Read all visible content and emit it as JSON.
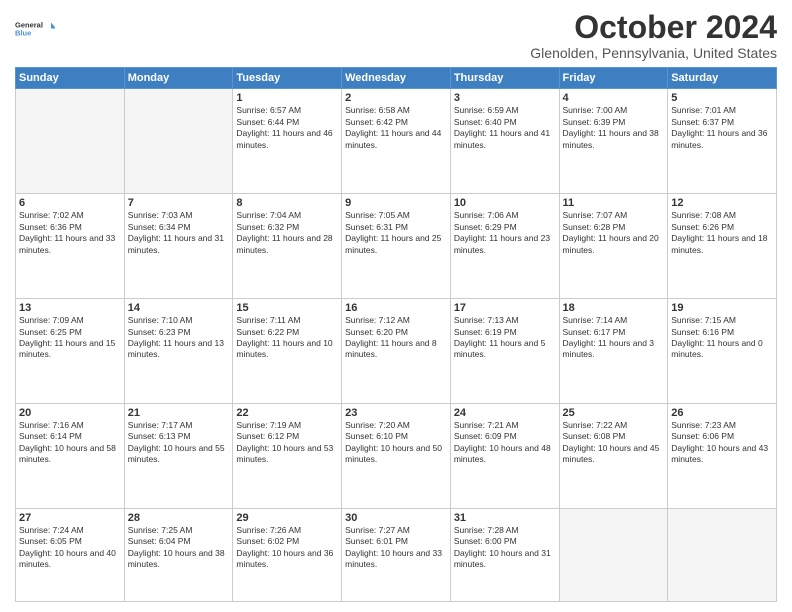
{
  "header": {
    "logo_line1": "General",
    "logo_line2": "Blue",
    "month_title": "October 2024",
    "subtitle": "Glenolden, Pennsylvania, United States"
  },
  "weekdays": [
    "Sunday",
    "Monday",
    "Tuesday",
    "Wednesday",
    "Thursday",
    "Friday",
    "Saturday"
  ],
  "weeks": [
    [
      {
        "day": "",
        "empty": true
      },
      {
        "day": "",
        "empty": true
      },
      {
        "day": "1",
        "sunrise": "6:57 AM",
        "sunset": "6:44 PM",
        "daylight": "11 hours and 46 minutes."
      },
      {
        "day": "2",
        "sunrise": "6:58 AM",
        "sunset": "6:42 PM",
        "daylight": "11 hours and 44 minutes."
      },
      {
        "day": "3",
        "sunrise": "6:59 AM",
        "sunset": "6:40 PM",
        "daylight": "11 hours and 41 minutes."
      },
      {
        "day": "4",
        "sunrise": "7:00 AM",
        "sunset": "6:39 PM",
        "daylight": "11 hours and 38 minutes."
      },
      {
        "day": "5",
        "sunrise": "7:01 AM",
        "sunset": "6:37 PM",
        "daylight": "11 hours and 36 minutes."
      }
    ],
    [
      {
        "day": "6",
        "sunrise": "7:02 AM",
        "sunset": "6:36 PM",
        "daylight": "11 hours and 33 minutes."
      },
      {
        "day": "7",
        "sunrise": "7:03 AM",
        "sunset": "6:34 PM",
        "daylight": "11 hours and 31 minutes."
      },
      {
        "day": "8",
        "sunrise": "7:04 AM",
        "sunset": "6:32 PM",
        "daylight": "11 hours and 28 minutes."
      },
      {
        "day": "9",
        "sunrise": "7:05 AM",
        "sunset": "6:31 PM",
        "daylight": "11 hours and 25 minutes."
      },
      {
        "day": "10",
        "sunrise": "7:06 AM",
        "sunset": "6:29 PM",
        "daylight": "11 hours and 23 minutes."
      },
      {
        "day": "11",
        "sunrise": "7:07 AM",
        "sunset": "6:28 PM",
        "daylight": "11 hours and 20 minutes."
      },
      {
        "day": "12",
        "sunrise": "7:08 AM",
        "sunset": "6:26 PM",
        "daylight": "11 hours and 18 minutes."
      }
    ],
    [
      {
        "day": "13",
        "sunrise": "7:09 AM",
        "sunset": "6:25 PM",
        "daylight": "11 hours and 15 minutes."
      },
      {
        "day": "14",
        "sunrise": "7:10 AM",
        "sunset": "6:23 PM",
        "daylight": "11 hours and 13 minutes."
      },
      {
        "day": "15",
        "sunrise": "7:11 AM",
        "sunset": "6:22 PM",
        "daylight": "11 hours and 10 minutes."
      },
      {
        "day": "16",
        "sunrise": "7:12 AM",
        "sunset": "6:20 PM",
        "daylight": "11 hours and 8 minutes."
      },
      {
        "day": "17",
        "sunrise": "7:13 AM",
        "sunset": "6:19 PM",
        "daylight": "11 hours and 5 minutes."
      },
      {
        "day": "18",
        "sunrise": "7:14 AM",
        "sunset": "6:17 PM",
        "daylight": "11 hours and 3 minutes."
      },
      {
        "day": "19",
        "sunrise": "7:15 AM",
        "sunset": "6:16 PM",
        "daylight": "11 hours and 0 minutes."
      }
    ],
    [
      {
        "day": "20",
        "sunrise": "7:16 AM",
        "sunset": "6:14 PM",
        "daylight": "10 hours and 58 minutes."
      },
      {
        "day": "21",
        "sunrise": "7:17 AM",
        "sunset": "6:13 PM",
        "daylight": "10 hours and 55 minutes."
      },
      {
        "day": "22",
        "sunrise": "7:19 AM",
        "sunset": "6:12 PM",
        "daylight": "10 hours and 53 minutes."
      },
      {
        "day": "23",
        "sunrise": "7:20 AM",
        "sunset": "6:10 PM",
        "daylight": "10 hours and 50 minutes."
      },
      {
        "day": "24",
        "sunrise": "7:21 AM",
        "sunset": "6:09 PM",
        "daylight": "10 hours and 48 minutes."
      },
      {
        "day": "25",
        "sunrise": "7:22 AM",
        "sunset": "6:08 PM",
        "daylight": "10 hours and 45 minutes."
      },
      {
        "day": "26",
        "sunrise": "7:23 AM",
        "sunset": "6:06 PM",
        "daylight": "10 hours and 43 minutes."
      }
    ],
    [
      {
        "day": "27",
        "sunrise": "7:24 AM",
        "sunset": "6:05 PM",
        "daylight": "10 hours and 40 minutes."
      },
      {
        "day": "28",
        "sunrise": "7:25 AM",
        "sunset": "6:04 PM",
        "daylight": "10 hours and 38 minutes."
      },
      {
        "day": "29",
        "sunrise": "7:26 AM",
        "sunset": "6:02 PM",
        "daylight": "10 hours and 36 minutes."
      },
      {
        "day": "30",
        "sunrise": "7:27 AM",
        "sunset": "6:01 PM",
        "daylight": "10 hours and 33 minutes."
      },
      {
        "day": "31",
        "sunrise": "7:28 AM",
        "sunset": "6:00 PM",
        "daylight": "10 hours and 31 minutes."
      },
      {
        "day": "",
        "empty": true
      },
      {
        "day": "",
        "empty": true
      }
    ]
  ]
}
